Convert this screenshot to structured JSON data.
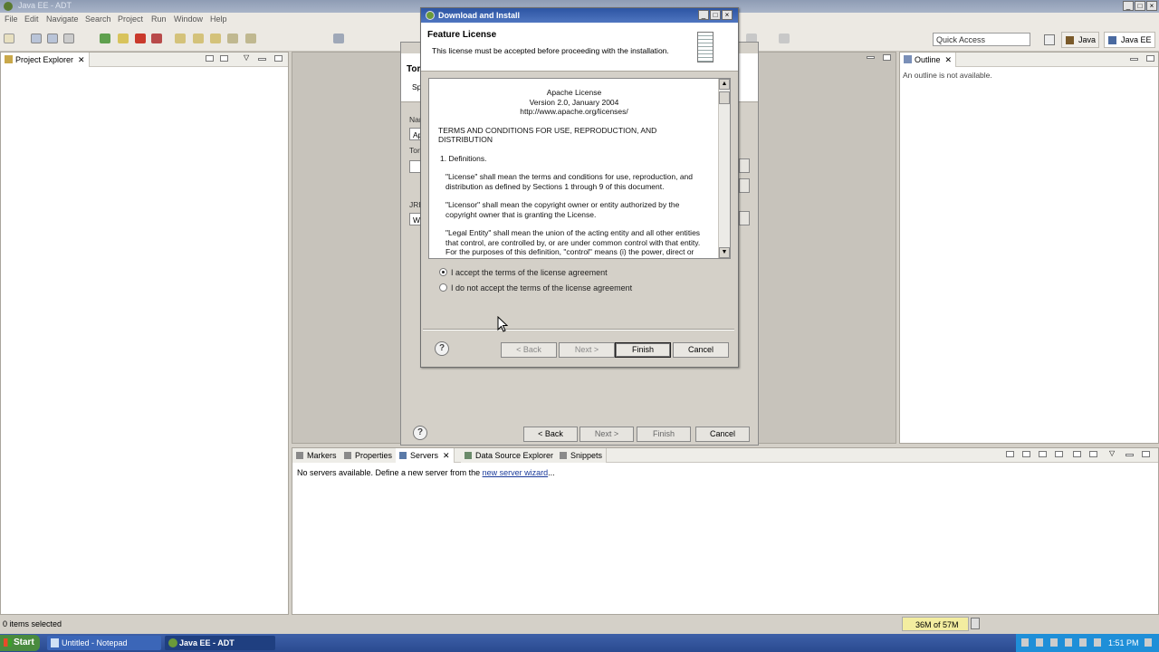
{
  "window": {
    "title": "Java EE - ADT"
  },
  "menu": [
    "File",
    "Edit",
    "Navigate",
    "Search",
    "Project",
    "Run",
    "Window",
    "Help"
  ],
  "toolbar": {
    "quick_access_placeholder": "Quick Access",
    "perspectives": [
      "Java",
      "Java EE"
    ]
  },
  "project_explorer": {
    "tab": "Project Explorer"
  },
  "outline": {
    "tab": "Outline",
    "message": "An outline is not available."
  },
  "bottom_panel": {
    "tabs": [
      "Markers",
      "Properties",
      "Servers",
      "Data Source Explorer",
      "Snippets"
    ],
    "active_tab": "Servers",
    "message_prefix": "No servers available. Define a new server from the ",
    "link": "new server wizard",
    "message_suffix": "..."
  },
  "status": {
    "left": "0 items selected",
    "memory": "36M of 57M"
  },
  "background_dialog": {
    "title_fragment": "Tor",
    "subtitle_fragment": "Spe",
    "labels": [
      "Nar",
      "Ap",
      "Tor",
      "JRE",
      "Wo"
    ],
    "buttons": {
      "back": "< Back",
      "next": "Next >",
      "finish": "Finish",
      "cancel": "Cancel"
    }
  },
  "dialog": {
    "title": "Download and Install",
    "header_title": "Feature License",
    "header_desc": "This license must be accepted before proceeding with the installation.",
    "license": [
      "Apache License",
      "Version 2.0, January 2004",
      "http://www.apache.org/licenses/",
      "TERMS AND CONDITIONS FOR USE, REPRODUCTION, AND DISTRIBUTION",
      "1. Definitions.",
      "\"License\" shall mean the terms and conditions for use, reproduction, and distribution as defined by Sections 1 through 9 of this document.",
      "\"Licensor\" shall mean the copyright owner or entity authorized by the copyright owner that is granting the License.",
      "\"Legal Entity\" shall mean the union of the acting entity and all other entities that control, are controlled by, or are under common control with that entity. For the purposes of this definition, \"control\" means (i) the power, direct or indirect, to cause the"
    ],
    "accept": "I accept the terms of the license agreement",
    "decline": "I do not accept the terms of the license agreement",
    "accepted": true,
    "buttons": {
      "back": "< Back",
      "next": "Next >",
      "finish": "Finish",
      "cancel": "Cancel"
    }
  },
  "taskbar": {
    "start": "Start",
    "tasks": [
      "Untitled - Notepad",
      "Java EE - ADT"
    ],
    "clock": "1:51 PM"
  }
}
